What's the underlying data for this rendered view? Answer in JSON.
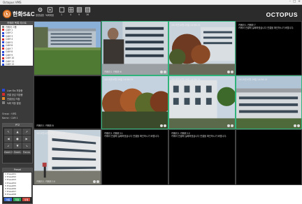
{
  "window": {
    "title": "Octopus VMS"
  },
  "toolbar": {
    "logo_text": "한화S&C",
    "buttons": [
      {
        "label": "환경설정",
        "icon": "settings-icon"
      },
      {
        "label": "녹화재생",
        "icon": "playback-icon"
      },
      {
        "label": "1",
        "icon": "layout-1-icon"
      },
      {
        "label": "4",
        "icon": "layout-4-icon"
      },
      {
        "label": "9",
        "icon": "layout-9-icon"
      },
      {
        "label": "16",
        "icon": "layout-16-icon"
      }
    ],
    "brand": "OCTOPUS"
  },
  "sidebar": {
    "header": "카메라 목록 리스트",
    "tree": [
      "카메라 그룹",
      "CAM 1",
      "CAM 2",
      "CAM 3",
      "CAM 4",
      "CAM 5",
      "CAM 6",
      "CAM 7",
      "CAM 8",
      "CAM 9",
      "CAM 10",
      "CAM 11",
      "CAM 12"
    ],
    "legend": [
      {
        "label": "Live Sts 저장중",
        "color": "#2b4bd6"
      },
      {
        "label": "연결 끊김 저장중",
        "color": "#d62b2b"
      },
      {
        "label": "연결끊김 저장",
        "color": "#e48a2a"
      },
      {
        "label": "녹화 저장 알림",
        "color": "#808080"
      }
    ],
    "info": [
      "Group : 서버1",
      "Name : CAM 1"
    ],
    "ptz": {
      "title": "PTZ",
      "keys": [
        "↖",
        "▲",
        "↗",
        "◀",
        "●",
        "▶",
        "↙",
        "▼",
        "↘"
      ],
      "zoom": [
        "Zoom+",
        "Zoom-",
        "Focus"
      ]
    },
    "preset": {
      "title": "Preset",
      "items": [
        "1 Preset01",
        "2 Preset02",
        "3 Preset03",
        "4 Preset04",
        "5 Preset05",
        "6 Preset06",
        "7 Preset07",
        "8 Preset08"
      ],
      "buttons": [
        "이동",
        "저장",
        "삭제"
      ]
    }
  },
  "cells": [
    {
      "top": "",
      "bottom": "",
      "msg": "",
      "scene": "campus"
    },
    {
      "top": "",
      "bottom": "카메라 1 카메라 6",
      "msg": "",
      "scene": "person"
    },
    {
      "top": "2013년10월 29일 14:56:15",
      "bottom": "",
      "msg": "",
      "scene": "trees"
    },
    {
      "top": "카메라 1 카메라 7",
      "bottom": "",
      "msg": "카메라 연결에 실패하였습니다 연결을 확인하시기 바랍니다.",
      "scene": "black"
    },
    {
      "top": "",
      "bottom": "카메라 1 카메라 8",
      "msg": "",
      "scene": "black"
    },
    {
      "top": "2013년10월 29일 14:56:15",
      "bottom": "",
      "msg": "",
      "scene": "forest"
    },
    {
      "top": "2013년10월 29일 14:56:15",
      "bottom": "",
      "msg": "",
      "scene": "building"
    },
    {
      "top": "2013년10월 29일 14:56:15",
      "bottom": "",
      "msg": "",
      "scene": "building2"
    },
    {
      "top": "2013년10월 29일 14:56:15",
      "bottom": "카메라 1 카메라 10",
      "msg": "",
      "scene": "person2"
    },
    {
      "top": "카메라 1 카메라 11",
      "bottom": "",
      "msg": "카메라 연결에 실패하였습니다 연결을 확인하시기 바랍니다.",
      "scene": "black"
    },
    {
      "top": "카메라 1 카메라 12",
      "bottom": "",
      "msg": "카메라 연결에 실패하였습니다 연결을 확인하시기 바랍니다.",
      "scene": "black"
    },
    {
      "top": "",
      "bottom": "",
      "msg": "",
      "scene": "black"
    }
  ]
}
